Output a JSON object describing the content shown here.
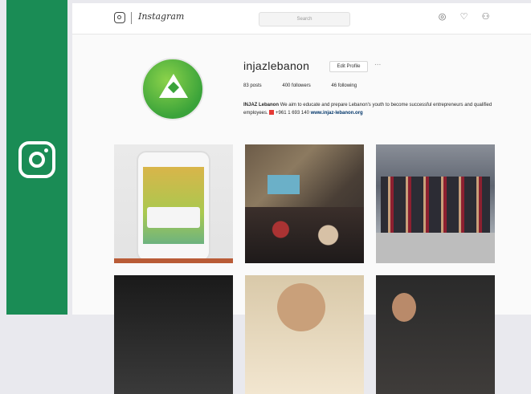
{
  "topbar": {
    "wordmark": "Instagram",
    "search_placeholder": "Search",
    "icons": [
      "compass-icon",
      "heart-icon",
      "user-icon"
    ]
  },
  "profile": {
    "username": "injazlebanon",
    "edit_button": "Edit Profile",
    "more": "...",
    "stats": {
      "posts": "83 posts",
      "followers": "400 followers",
      "following": "46 following"
    },
    "bio_name": "INJAZ Lebanon",
    "bio_text": "We aim to educate and prepare Lebanon's youth to become successful entrepreneurs and qualified employees.",
    "bio_phone": "+961 1 693 140",
    "bio_link": "www.injaz-lebanon.org"
  },
  "colors": {
    "brand_green": "#1a8c55",
    "link_blue": "#003569"
  }
}
